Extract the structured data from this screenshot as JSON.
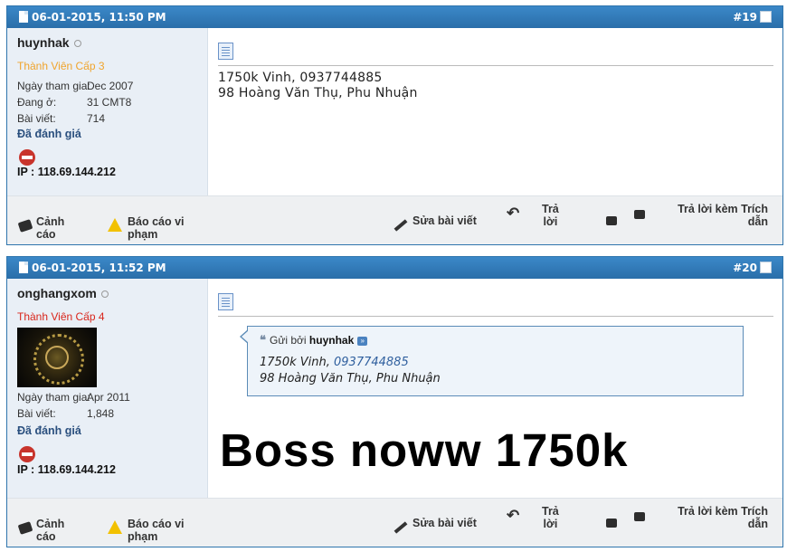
{
  "posts": [
    {
      "date": "06-01-2015, 11:50 PM",
      "number": "#19",
      "username": "huynhak",
      "rank": "Thành Viên Cấp 3",
      "rank_color": "#f0a42c",
      "meta": [
        {
          "label": "Ngày tham gia:",
          "value": "Dec 2007"
        },
        {
          "label": "Đang ở:",
          "value": "31 CMT8"
        },
        {
          "label": "Bài viết:",
          "value": "714"
        }
      ],
      "rated": "Đã đánh giá",
      "ip": "IP : 118.69.144.212",
      "message_lines": [
        "1750k Vinh, 0937744885",
        "98 Hoàng Văn Thụ, Phu Nhuận"
      ]
    },
    {
      "date": "06-01-2015, 11:52 PM",
      "number": "#20",
      "username": "onghangxom",
      "rank": "Thành Viên Cấp 4",
      "rank_color": "#d9261c",
      "meta": [
        {
          "label": "Ngày tham gia:",
          "value": "Apr 2011"
        },
        {
          "label": "Bài viết:",
          "value": "1,848"
        }
      ],
      "rated": "Đã đánh giá",
      "ip": "IP : 118.69.144.212",
      "quote": {
        "prefix": "Gửi bởi",
        "author": "huynhak",
        "line1_text": "1750k Vinh,",
        "line1_phone": "0937744885",
        "line2": "98 Hoàng Văn Thụ, Phu Nhuận"
      },
      "big_text": "Boss noww 1750k"
    }
  ],
  "footer": {
    "warn_line1": "Cảnh",
    "warn_line2": "cáo",
    "report_line1": "Báo cáo vi",
    "report_line2": "phạm",
    "edit": "Sửa bài viết",
    "reply_line1": "Trả",
    "reply_line2": "lời",
    "reply_quote_line1": "Trả lời kèm Trích",
    "reply_quote_line2": "dẫn"
  },
  "icons": {
    "post": "document-icon",
    "online": "offline-status-icon",
    "no_entry": "no-entry-icon",
    "warning": "warning-triangle-icon",
    "card": "warning-card-icon",
    "edit": "pencil-icon",
    "undo": "reply-arrow-icon",
    "multiquote": "multiquote-icon",
    "quick": "quick-reply-icon",
    "quote_marks": "quote-marks-icon",
    "go_to_post": "go-to-post-icon"
  }
}
